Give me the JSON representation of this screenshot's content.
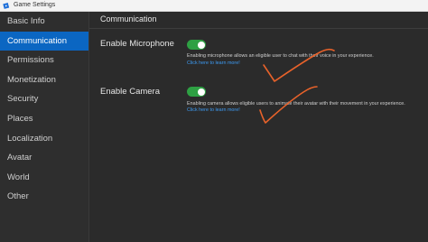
{
  "window": {
    "title": "Game Settings"
  },
  "sidebar": {
    "items": [
      {
        "label": "Basic Info",
        "active": false
      },
      {
        "label": "Communication",
        "active": true
      },
      {
        "label": "Permissions",
        "active": false
      },
      {
        "label": "Monetization",
        "active": false
      },
      {
        "label": "Security",
        "active": false
      },
      {
        "label": "Places",
        "active": false
      },
      {
        "label": "Localization",
        "active": false
      },
      {
        "label": "Avatar",
        "active": false
      },
      {
        "label": "World",
        "active": false
      },
      {
        "label": "Other",
        "active": false
      }
    ]
  },
  "main": {
    "section_title": "Communication",
    "settings": [
      {
        "label": "Enable Microphone",
        "enabled": true,
        "description": "Enabling microphone allows an eligible user to chat with their voice in your experience.",
        "link": "Click here to learn more!"
      },
      {
        "label": "Enable Camera",
        "enabled": true,
        "description": "Enabling camera allows eligible users to animate their avatar with their movement in your experience.",
        "link": "Click here to learn more!"
      }
    ]
  },
  "colors": {
    "accent": "#0b66c2",
    "toggle_on": "#2ea043",
    "link": "#3d9cf5",
    "annotation": "#e8622a"
  }
}
